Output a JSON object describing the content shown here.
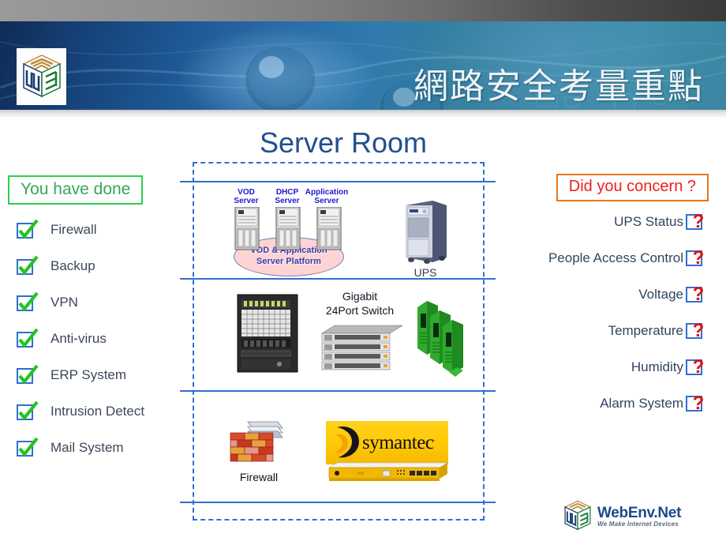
{
  "header": {
    "title_zh": "網路安全考量重點",
    "logo_icon": "webenv-cube-logo"
  },
  "center": {
    "room_title": "Server Room",
    "row1": {
      "servers": [
        {
          "line1": "VOD",
          "line2": "Server"
        },
        {
          "line1": "DHCP",
          "line2": "Server"
        },
        {
          "line1": "Application",
          "line2": "Server"
        }
      ],
      "platform_label_line1": "VOD & Application",
      "platform_label_line2": "Server Platform",
      "ups_label": "UPS"
    },
    "row2": {
      "switch_label_line1": "Gigabit",
      "switch_label_line2": "24Port Switch"
    },
    "row3": {
      "firewall_label": "Firewall",
      "symantec_brand": "symantec",
      "symantec_tm": "."
    }
  },
  "left": {
    "heading": "You have done",
    "items": [
      {
        "label": "Firewall"
      },
      {
        "label": "Backup"
      },
      {
        "label": "VPN"
      },
      {
        "label": "Anti-virus"
      },
      {
        "label": "ERP System"
      },
      {
        "label": "Intrusion Detect"
      },
      {
        "label": "Mail System"
      }
    ]
  },
  "right": {
    "heading": "Did you concern ?",
    "items": [
      {
        "label": "UPS Status"
      },
      {
        "label": "People Access Control"
      },
      {
        "label": "Voltage"
      },
      {
        "label": "Temperature"
      },
      {
        "label": "Humidity"
      },
      {
        "label": "Alarm System"
      }
    ]
  },
  "footer": {
    "brand": "WebEnv.Net",
    "tagline": "We Make Internet Devices"
  },
  "colors": {
    "banner_dark_blue": "#0f2c55",
    "banner_teal": "#3b86a2",
    "title_blue": "#205090",
    "check_green": "#2ad14a",
    "done_text_green": "#35a85a",
    "concern_red": "#f01d1d",
    "concern_border_orange": "#e8761a",
    "line_blue": "#2f6fd0",
    "label_slate": "#3c4758",
    "symantec_yellow": "#ffc806"
  }
}
